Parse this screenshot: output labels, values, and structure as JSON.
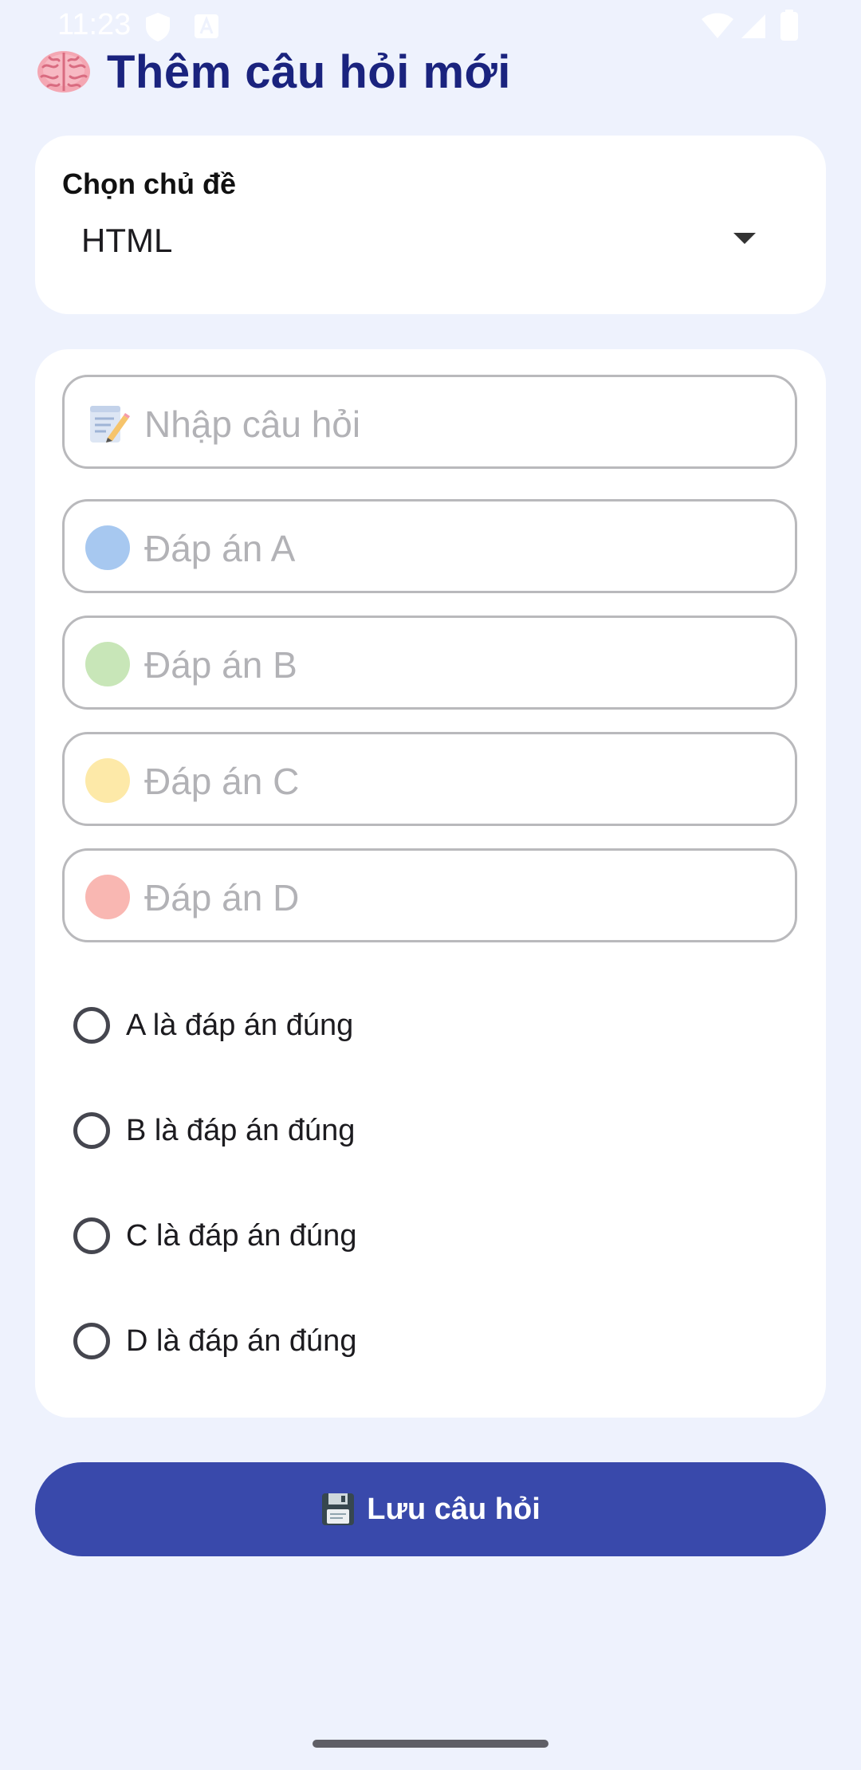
{
  "status_bar": {
    "time": "11:23",
    "icons": [
      "shield-icon",
      "a-keyboard-icon",
      "wifi-icon",
      "signal-icon",
      "battery-icon"
    ]
  },
  "header": {
    "icon": "brain-icon",
    "title": "Thêm câu hỏi mới"
  },
  "topic": {
    "label": "Chọn chủ đề",
    "selected": "HTML",
    "icon": "dropdown-arrow-icon"
  },
  "form": {
    "question": {
      "icon": "memo-pencil-icon",
      "placeholder": "Nhập câu hỏi",
      "value": ""
    },
    "answers": [
      {
        "icon": "blue-circle-icon",
        "color": "#a7c8f0",
        "placeholder": "Đáp án A",
        "value": ""
      },
      {
        "icon": "green-circle-icon",
        "color": "#c8e6b8",
        "placeholder": "Đáp án B",
        "value": ""
      },
      {
        "icon": "yellow-circle-icon",
        "color": "#fde9a8",
        "placeholder": "Đáp án C",
        "value": ""
      },
      {
        "icon": "red-circle-icon",
        "color": "#f9b7b2",
        "placeholder": "Đáp án D",
        "value": ""
      }
    ],
    "correct_options": [
      {
        "label": "A là đáp án đúng",
        "selected": false
      },
      {
        "label": "B là đáp án đúng",
        "selected": false
      },
      {
        "label": "C là đáp án đúng",
        "selected": false
      },
      {
        "label": "D là đáp án đúng",
        "selected": false
      }
    ]
  },
  "save_button": {
    "icon": "floppy-disk-icon",
    "label": "Lưu câu hỏi"
  },
  "colors": {
    "background": "#eef2fd",
    "title": "#1a237e",
    "primary": "#3949ab",
    "field_border": "#b9b9bc",
    "placeholder": "#b2b2b6"
  }
}
